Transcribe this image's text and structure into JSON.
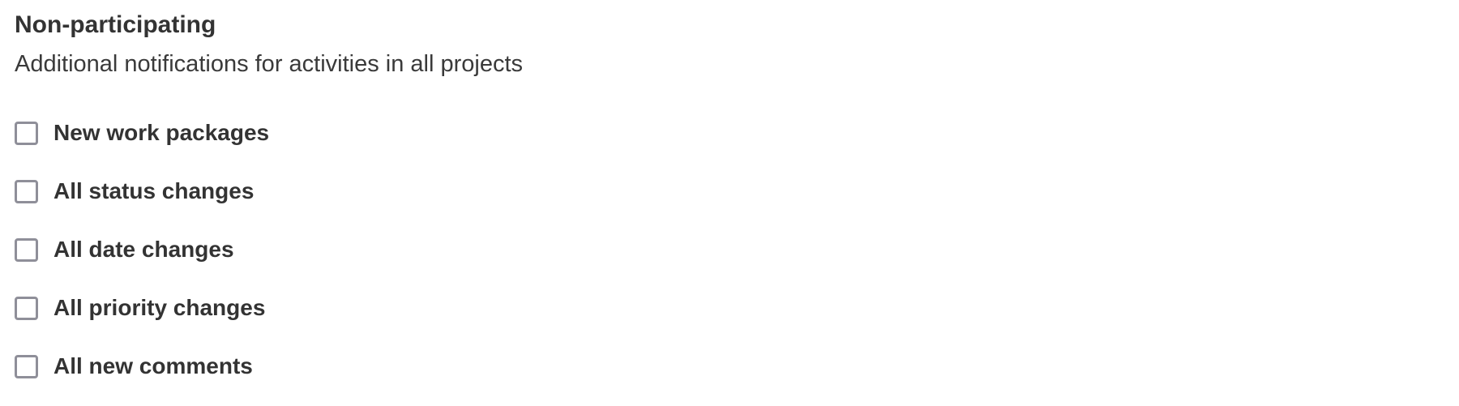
{
  "section": {
    "title": "Non-participating",
    "description": "Additional notifications for activities in all projects"
  },
  "options": [
    {
      "label": "New work packages",
      "checked": false
    },
    {
      "label": "All status changes",
      "checked": false
    },
    {
      "label": "All date changes",
      "checked": false
    },
    {
      "label": "All priority changes",
      "checked": false
    },
    {
      "label": "All new comments",
      "checked": false
    }
  ],
  "colors": {
    "text": "#333333",
    "checkbox_border": "#8f8f99",
    "background": "#ffffff"
  }
}
